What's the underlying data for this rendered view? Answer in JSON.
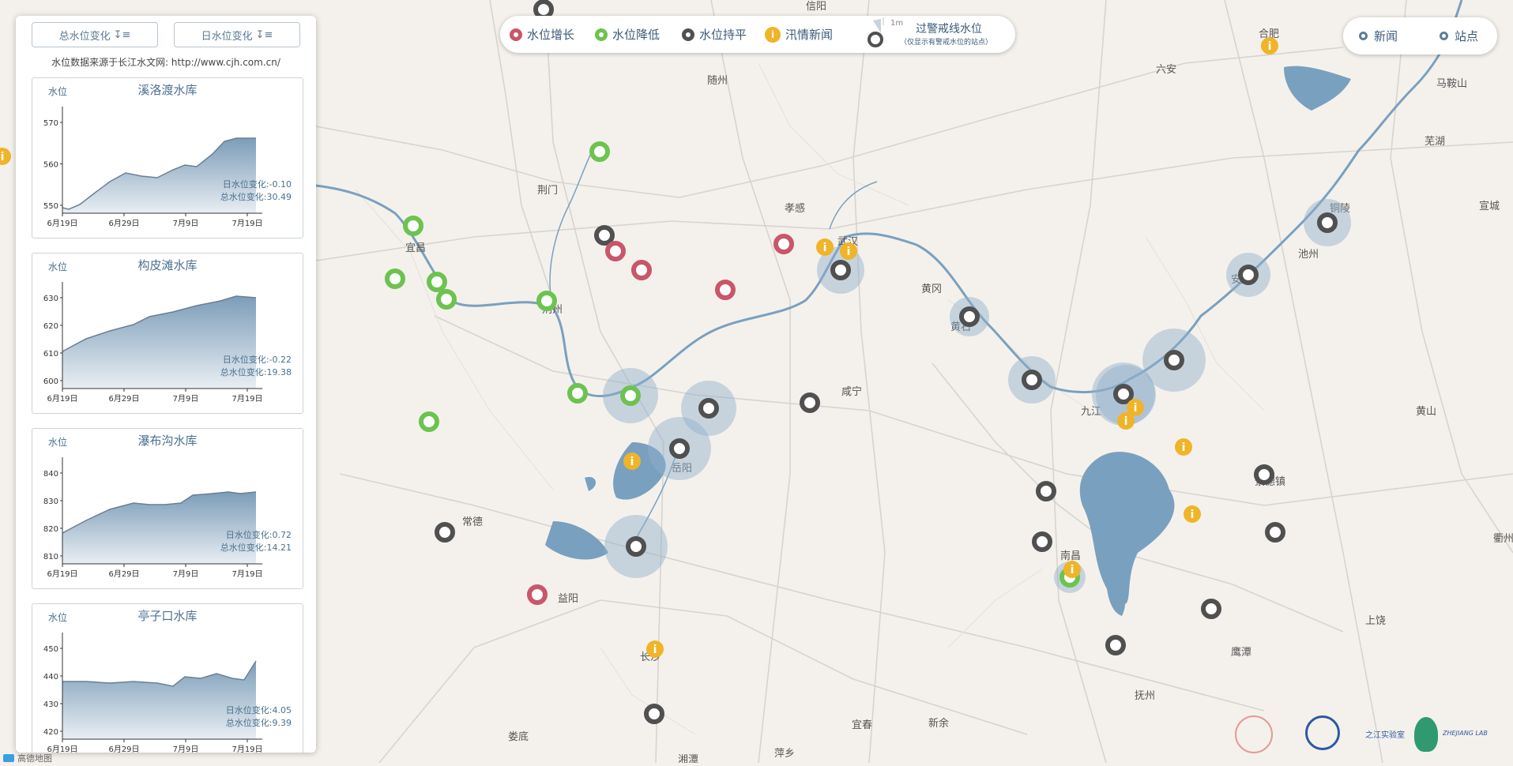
{
  "panel": {
    "btn_total": "总水位变化",
    "btn_daily": "日水位变化",
    "source": "水位数据来源于长江水文网: http://www.cjh.com.cn/",
    "y_label": "水位",
    "x_ticks": [
      "6月19日",
      "6月29日",
      "7月9日",
      "7月19日"
    ],
    "cards": [
      {
        "title": "溪洛渡水库",
        "yticks": [
          "570",
          "560",
          "550"
        ],
        "daily": "日水位变化:-0.10",
        "total": "总水位变化:30.49"
      },
      {
        "title": "构皮滩水库",
        "yticks": [
          "630",
          "620",
          "610",
          "600"
        ],
        "daily": "日水位变化:-0.22",
        "total": "总水位变化:19.38"
      },
      {
        "title": "瀑布沟水库",
        "yticks": [
          "840",
          "830",
          "820",
          "810"
        ],
        "daily": "日水位变化:0.72",
        "total": "总水位变化:14.21"
      },
      {
        "title": "亭子口水库",
        "yticks": [
          "450",
          "440",
          "430",
          "420"
        ],
        "daily": "日水位变化:4.05",
        "total": "总水位变化:9.39"
      }
    ]
  },
  "legend": {
    "rise": "水位增长",
    "fall": "水位降低",
    "flat": "水位持平",
    "news": "汛情新闻",
    "scale": "1m",
    "warn_title": "过警戒线水位",
    "warn_note": "（仅显示有警戒水位的站点）"
  },
  "toggle": {
    "news": "新闻",
    "stations": "站点"
  },
  "colors": {
    "rise": "#c9566a",
    "fall": "#6cc34f",
    "flat": "#505050",
    "news": "#f0b429",
    "river": "#6b96ba",
    "panel_text": "#4a7090"
  },
  "cities": [
    "信阳",
    "合肥",
    "六安",
    "马鞍山",
    "随州",
    "芜湖",
    "荆门",
    "孝感",
    "宜昌",
    "铜陵",
    "宣城",
    "武汉",
    "池州",
    "黄冈",
    "安庆",
    "荆州",
    "黄石",
    "咸宁",
    "九江",
    "岳阳",
    "黄山",
    "景德镇",
    "常德",
    "南昌",
    "衢州",
    "益阳",
    "上饶",
    "长沙",
    "鹰潭",
    "抚州",
    "宜春",
    "新余",
    "娄底",
    "萍乡",
    "湘潭"
  ],
  "footer": {
    "map_vendor": "高德地图",
    "lab": "之江实验室",
    "lab_en": "ZHEJIANG LAB"
  }
}
